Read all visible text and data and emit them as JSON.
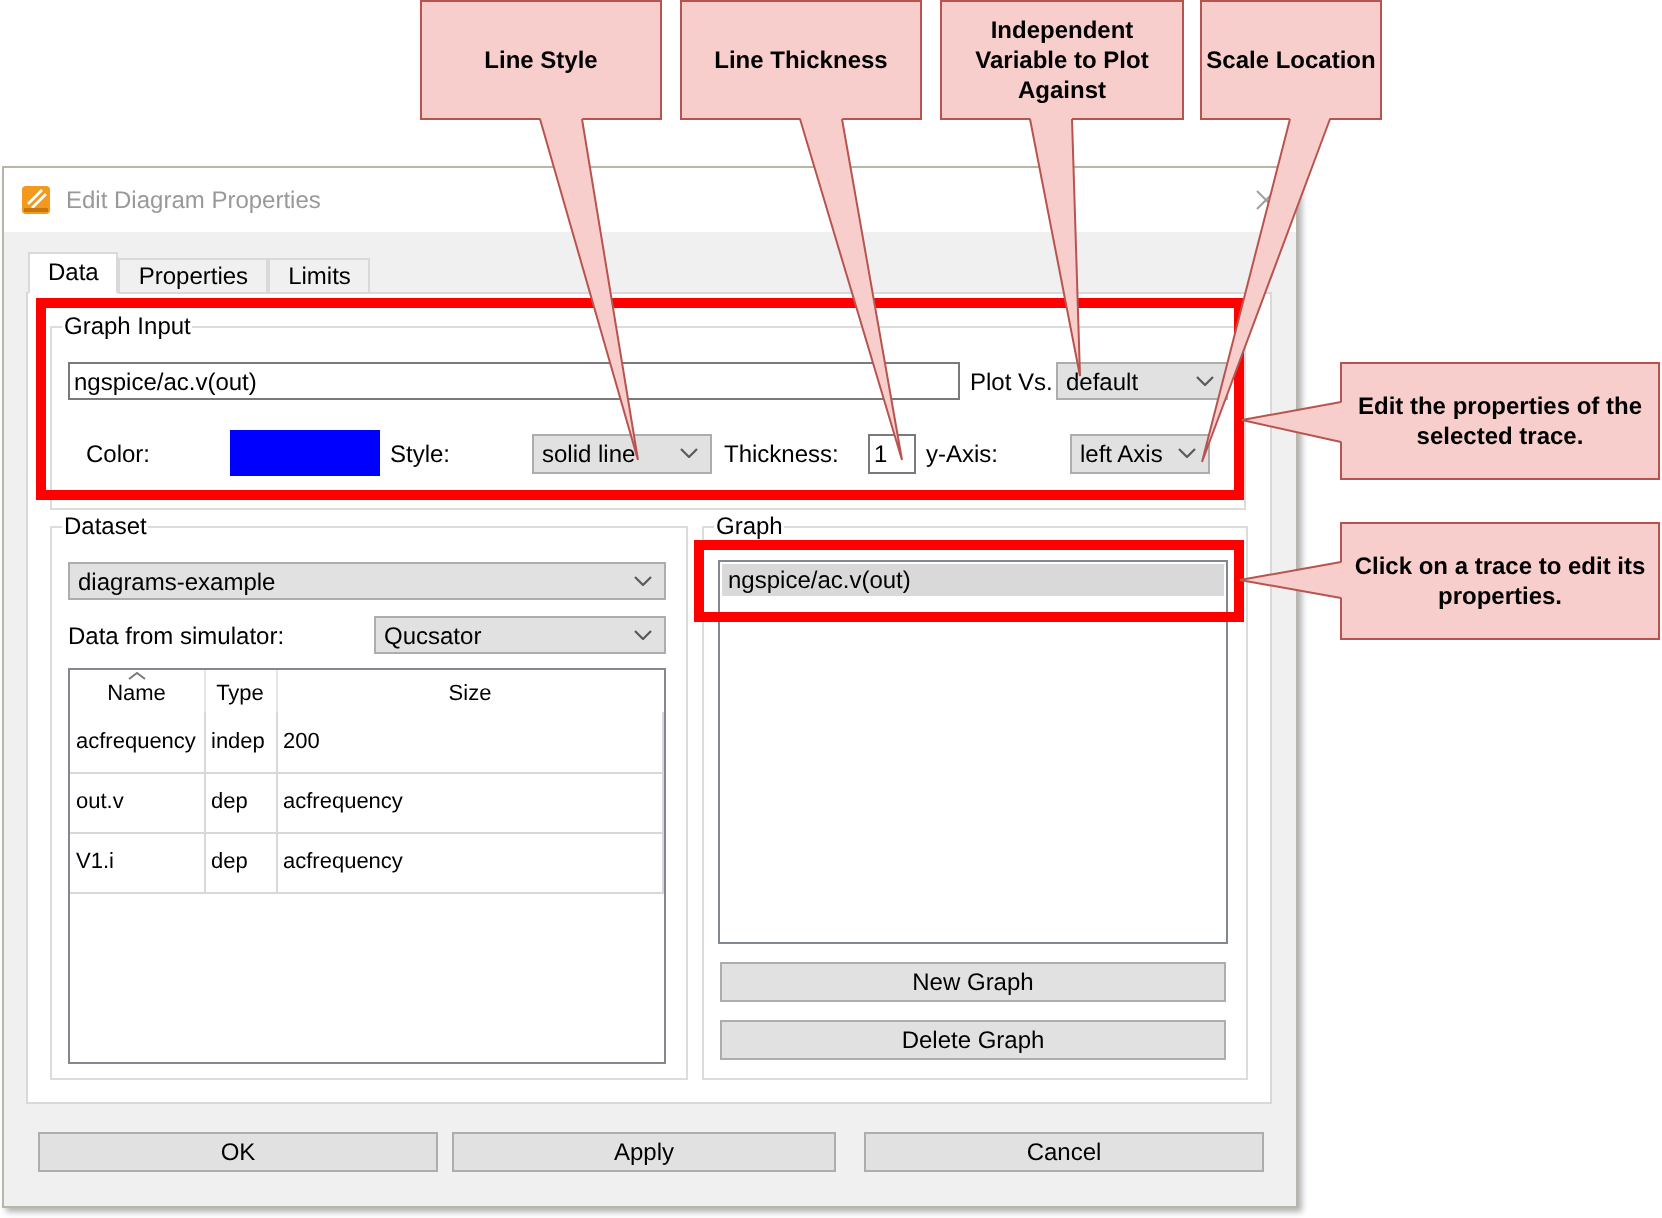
{
  "window": {
    "title": "Edit Diagram Properties"
  },
  "tabs": [
    {
      "label": "Data",
      "selected": true
    },
    {
      "label": "Properties",
      "selected": false
    },
    {
      "label": "Limits",
      "selected": false
    }
  ],
  "graph_input": {
    "title": "Graph Input",
    "highlighted": true,
    "expression": "ngspice/ac.v(out)",
    "plot_vs": {
      "label": "Plot Vs.",
      "value": "default"
    },
    "color_picker": {
      "label": "Color:",
      "color": "#0000ff"
    },
    "style": {
      "label": "Style:",
      "value": "solid line"
    },
    "thickness": {
      "label": "Thickness:",
      "value": "1"
    },
    "y_axis": {
      "label": "y-Axis:",
      "value": "left Axis"
    }
  },
  "dataset": {
    "title": "Dataset",
    "file": "diagrams-example",
    "simulator": {
      "label": "Data from simulator:",
      "value": "Qucsator"
    },
    "table": {
      "columns": [
        {
          "label": "Name",
          "sorted": true
        },
        {
          "label": "Type",
          "sorted": false
        },
        {
          "label": "Size",
          "sorted": false
        }
      ],
      "rows": [
        [
          "acfrequency",
          "indep",
          "200"
        ],
        [
          "out.v",
          "dep",
          "acfrequency"
        ],
        [
          "V1.i",
          "dep",
          "acfrequency"
        ]
      ]
    }
  },
  "graph": {
    "title": "Graph",
    "highlighted": true,
    "traces": [
      {
        "label": "ngspice/ac.v(out)",
        "selected": true
      }
    ],
    "buttons": [
      "New Graph",
      "Delete Graph"
    ]
  },
  "buttons": [
    "OK",
    "Apply",
    "Cancel"
  ],
  "callouts": [
    "Line Style",
    "Line Thickness",
    "Independent Variable to Plot Against",
    "Scale Location",
    "Edit the properties of the selected trace.",
    "Click on a trace to edit its properties."
  ]
}
